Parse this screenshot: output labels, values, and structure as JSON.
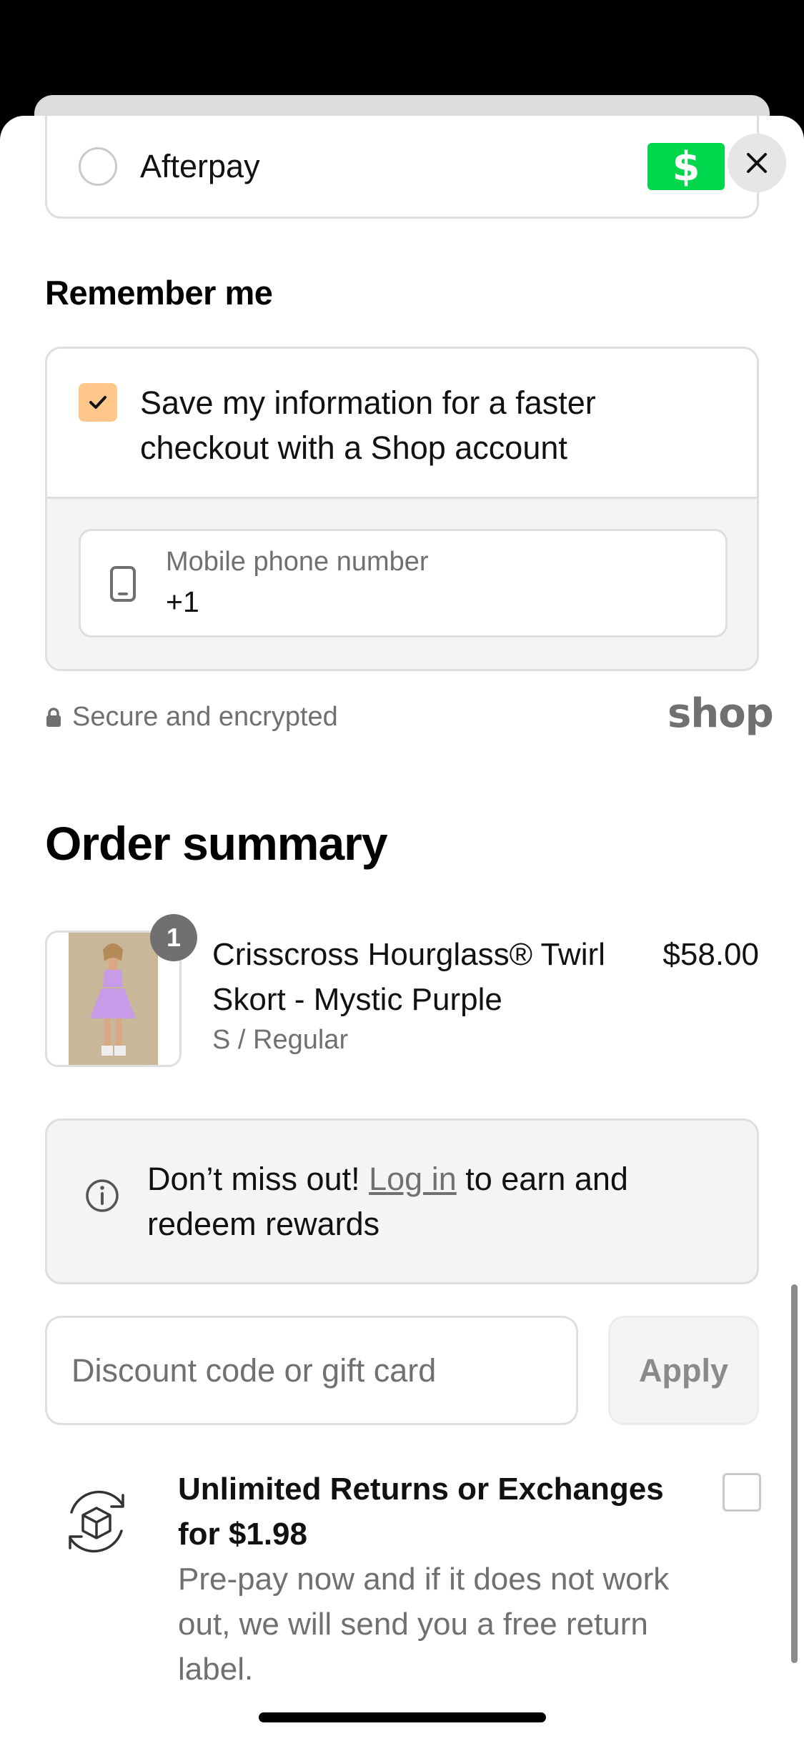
{
  "payment": {
    "afterpay_label": "Afterpay",
    "cash_badge_symbol": "$",
    "cash_badge_color": "#00d64b"
  },
  "remember": {
    "heading": "Remember me",
    "save_text": "Save my information for a faster checkout with a Shop account",
    "checkbox_checked": true,
    "checkbox_color": "#ffc88a",
    "phone_placeholder": "Mobile phone number",
    "phone_value": "+1"
  },
  "security": {
    "text": "Secure and encrypted",
    "brand": "shop"
  },
  "order": {
    "heading": "Order summary",
    "item": {
      "quantity": "1",
      "name": "Crisscross Hourglass® Twirl Skort - Mystic Purple",
      "variant": "S / Regular",
      "price": "$58.00"
    },
    "notice_prefix": "Don’t miss out!",
    "notice_link": "Log in",
    "notice_suffix": "to earn and redeem rewards",
    "discount_placeholder": "Discount code or gift card",
    "apply_label": "Apply"
  },
  "returns": {
    "title": "Unlimited Returns or Exchanges for $1.98",
    "description": "Pre-pay now and if it does not work out, we will send you a free return label.",
    "checked": false
  }
}
